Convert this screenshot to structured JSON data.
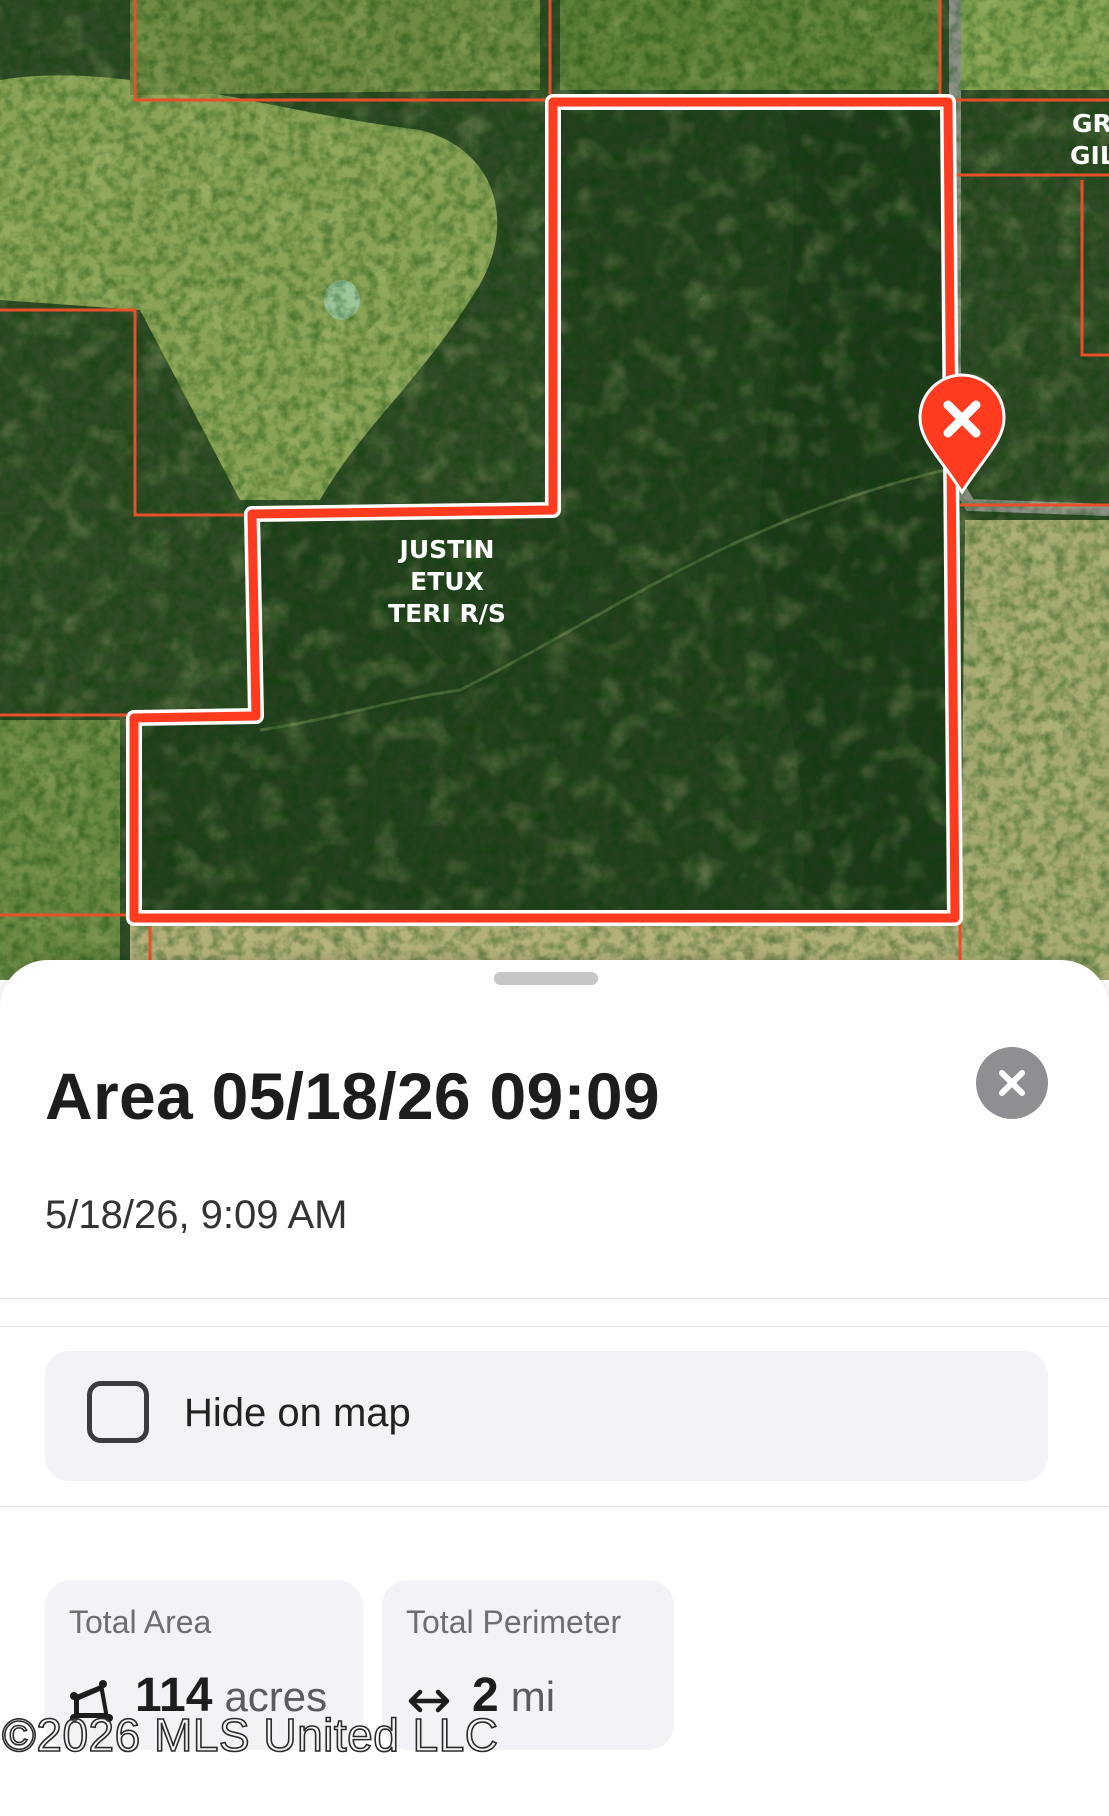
{
  "map": {
    "parcel_label_lines": [
      "JUSTIN",
      "ETUX",
      "TERI R/S"
    ],
    "edge_label_lines": [
      "GR",
      "GIL"
    ],
    "parcel_color": "#ff3b1f",
    "boundary_color": "#e8502a",
    "marker_icon": "close-x-icon"
  },
  "sheet": {
    "title": "Area 05/18/26 09:09",
    "date": "5/18/26, 9:09 AM",
    "close_icon": "close-icon",
    "hide_on_map": {
      "label": "Hide on map",
      "checked": false
    },
    "stats": [
      {
        "title": "Total Area",
        "icon": "area-icon",
        "value": "114",
        "unit": "acres"
      },
      {
        "title": "Total Perimeter",
        "icon": "arrows-horizontal-icon",
        "value": "2",
        "unit": "mi"
      }
    ]
  },
  "watermark": "©2026 MLS United LLC"
}
